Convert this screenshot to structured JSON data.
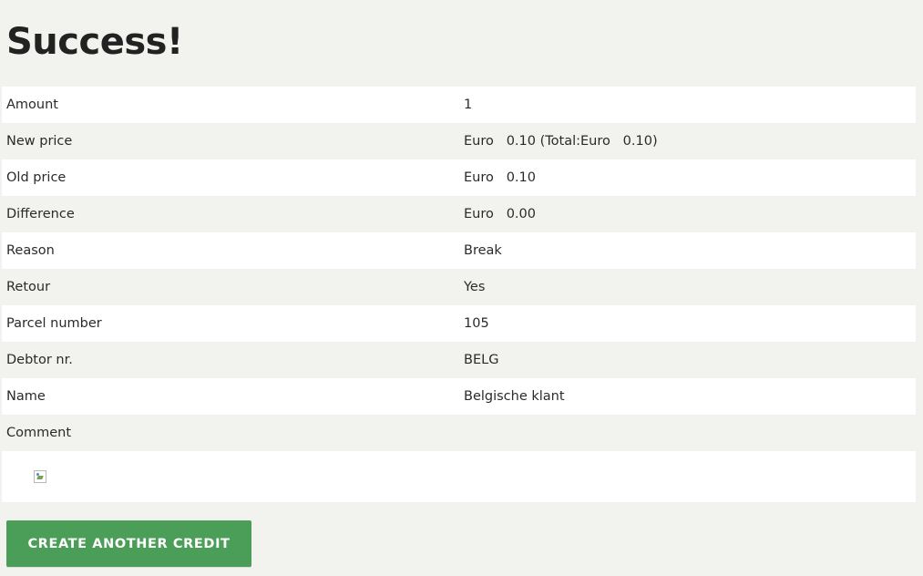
{
  "page": {
    "title": "Success!"
  },
  "details": [
    {
      "label": "Amount",
      "value": "1"
    },
    {
      "label": "New price",
      "value": "Euro   0.10 (Total:Euro   0.10)"
    },
    {
      "label": "Old price",
      "value": "Euro   0.10"
    },
    {
      "label": "Difference",
      "value": "Euro   0.00"
    },
    {
      "label": "Reason",
      "value": "Break"
    },
    {
      "label": "Retour",
      "value": "Yes"
    },
    {
      "label": "Parcel number",
      "value": "105"
    },
    {
      "label": "Debtor nr.",
      "value": "BELG"
    },
    {
      "label": "Name",
      "value": "Belgische klant"
    },
    {
      "label": "Comment",
      "value": ""
    }
  ],
  "actions": {
    "create_another_label": "CREATE ANOTHER CREDIT"
  },
  "colors": {
    "background": "#f2f3ee",
    "row_alt": "#ffffff",
    "button": "#4a9e57",
    "button_text": "#ffffff",
    "text": "#2a2a2a"
  },
  "icons": {
    "comment_image": "broken-image-icon"
  }
}
